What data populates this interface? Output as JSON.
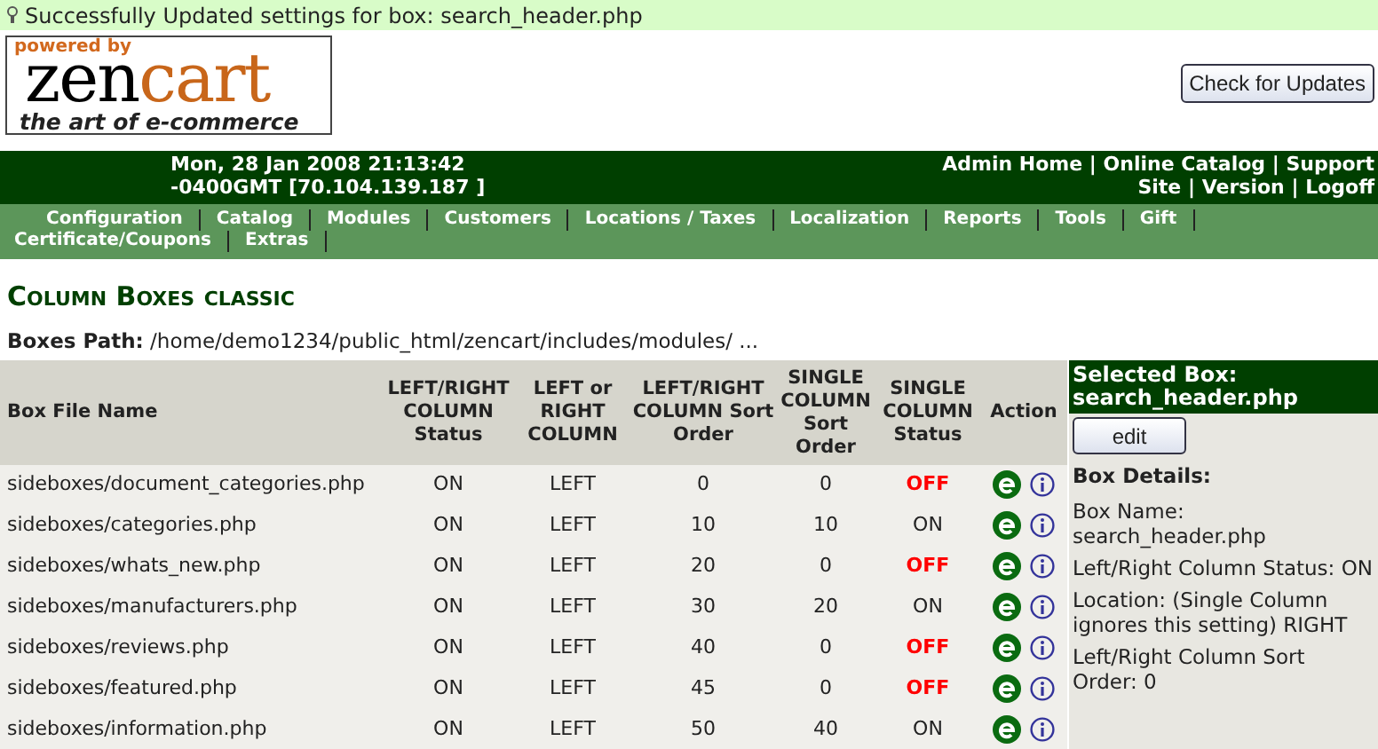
{
  "message": {
    "text": "Successfully Updated settings for box: search_header.php"
  },
  "logo": {
    "tagline_top": "powered by",
    "word_1": "zen",
    "word_2": "cart",
    "tagline": "the art of e-commerce"
  },
  "check_button": "Check for Updates",
  "header": {
    "datetime": "Mon, 28 Jan 2008 21:13:42 -0400GMT [70.104.139.187 ]",
    "link_lines": [
      [
        "Admin Home",
        "Online Catalog",
        "Support"
      ],
      [
        "Site",
        "Version",
        "Logoff"
      ]
    ],
    "separator": "|"
  },
  "menu_lines": [
    [
      "Configuration",
      "Catalog",
      "Modules",
      "Customers",
      "Locations / Taxes",
      "Localization",
      "Reports",
      "Tools",
      "Gift"
    ],
    [
      "Certificate/Coupons",
      "Extras"
    ]
  ],
  "page_title": "Column Boxes classic",
  "path": {
    "label": "Boxes Path:",
    "value": "/home/demo1234/public_html/zencart/includes/modules/ ..."
  },
  "table": {
    "columns": [
      "Box File Name",
      "LEFT/RIGHT COLUMN Status",
      "LEFT or RIGHT COLUMN",
      "LEFT/RIGHT COLUMN Sort Order",
      "SINGLE COLUMN Sort Order",
      "SINGLE COLUMN Status",
      "Action"
    ],
    "rows": [
      {
        "file": "sideboxes/document_categories.php",
        "status": "ON",
        "column": "LEFT",
        "sort": "0",
        "single_sort": "0",
        "single_status": "OFF",
        "single_on": false
      },
      {
        "file": "sideboxes/categories.php",
        "status": "ON",
        "column": "LEFT",
        "sort": "10",
        "single_sort": "10",
        "single_status": "ON",
        "single_on": true
      },
      {
        "file": "sideboxes/whats_new.php",
        "status": "ON",
        "column": "LEFT",
        "sort": "20",
        "single_sort": "0",
        "single_status": "OFF",
        "single_on": false
      },
      {
        "file": "sideboxes/manufacturers.php",
        "status": "ON",
        "column": "LEFT",
        "sort": "30",
        "single_sort": "20",
        "single_status": "ON",
        "single_on": true
      },
      {
        "file": "sideboxes/reviews.php",
        "status": "ON",
        "column": "LEFT",
        "sort": "40",
        "single_sort": "0",
        "single_status": "OFF",
        "single_on": false
      },
      {
        "file": "sideboxes/featured.php",
        "status": "ON",
        "column": "LEFT",
        "sort": "45",
        "single_sort": "0",
        "single_status": "OFF",
        "single_on": false
      },
      {
        "file": "sideboxes/information.php",
        "status": "ON",
        "column": "LEFT",
        "sort": "50",
        "single_sort": "40",
        "single_status": "ON",
        "single_on": true
      }
    ]
  },
  "selected_box": {
    "title": "Selected Box: search_header.php",
    "edit_button": "edit",
    "details_heading": "Box Details:",
    "details": [
      "Box Name: search_header.php",
      "Left/Right Column Status: ON",
      "Location: (Single Column ignores this setting) RIGHT",
      "Left/Right Column Sort Order: 0"
    ]
  }
}
